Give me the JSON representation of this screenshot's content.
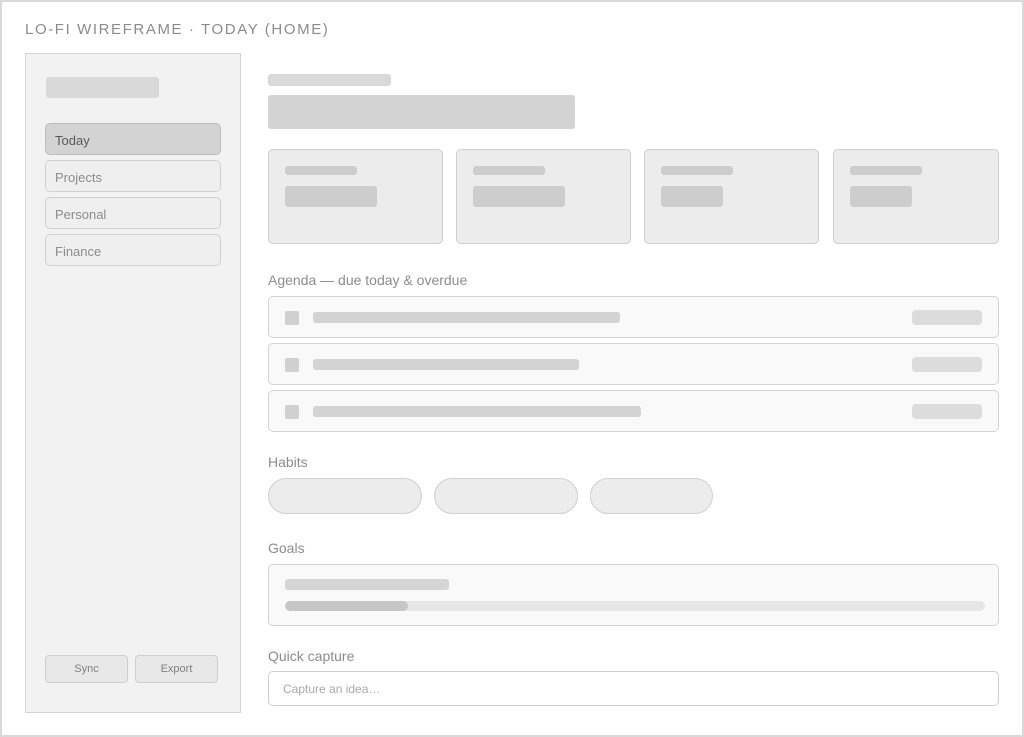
{
  "heading": "LO-FI WIREFRAME · TODAY (HOME)",
  "sidebar": {
    "nav": [
      {
        "label": "Today",
        "active": true
      },
      {
        "label": "Projects",
        "active": false
      },
      {
        "label": "Personal",
        "active": false
      },
      {
        "label": "Finance",
        "active": false
      }
    ],
    "sync_label": "Sync",
    "export_label": "Export"
  },
  "sections": {
    "agenda": "Agenda — due today & overdue",
    "habits": "Habits",
    "goals": "Goals",
    "quick_capture": "Quick capture"
  },
  "quick_capture": {
    "placeholder": "Capture an idea…"
  },
  "goal": {
    "progress": 0.175
  },
  "colors": {
    "placeholder_fill": "#d9d9d9",
    "active_nav": "#d3d3d3",
    "frame_border": "#d9d9d9"
  }
}
